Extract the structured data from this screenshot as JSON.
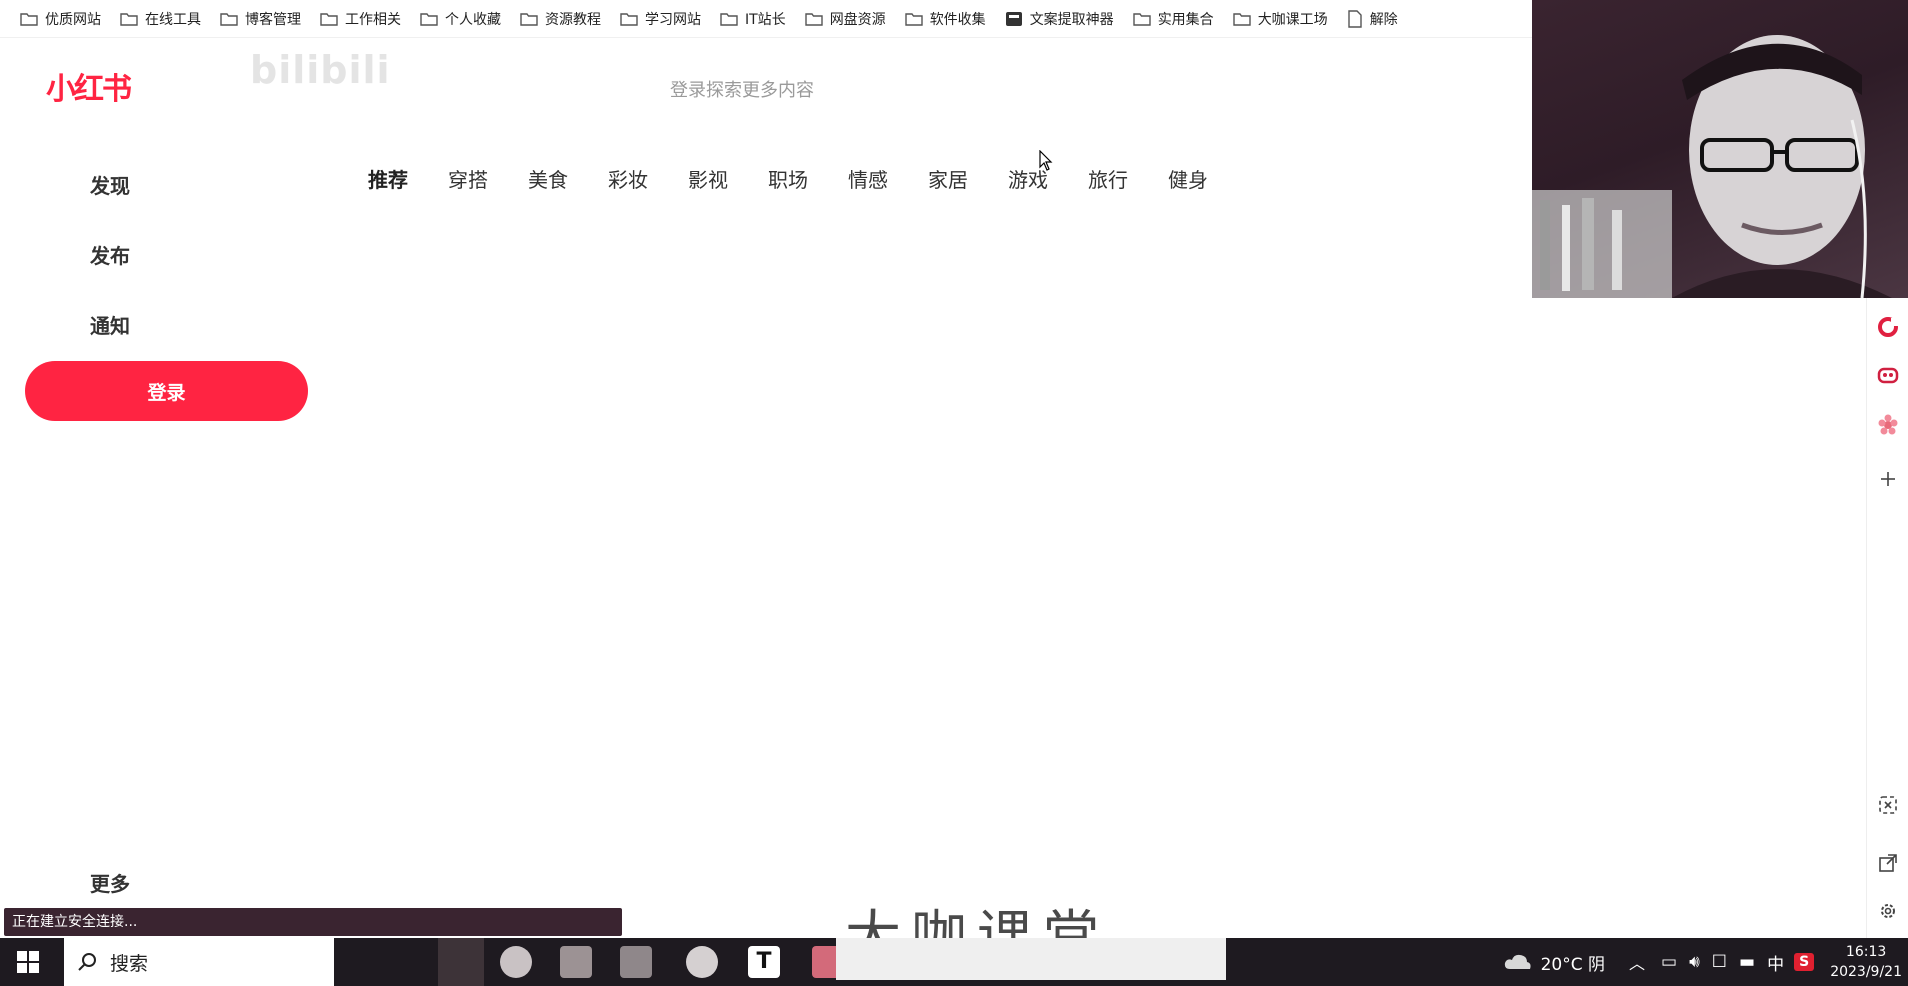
{
  "bookmarks": [
    {
      "label": "优质网站",
      "icon": "folder-icon"
    },
    {
      "label": "在线工具",
      "icon": "folder-icon"
    },
    {
      "label": "博客管理",
      "icon": "folder-icon"
    },
    {
      "label": "工作相关",
      "icon": "folder-icon"
    },
    {
      "label": "个人收藏",
      "icon": "folder-icon"
    },
    {
      "label": "资源教程",
      "icon": "folder-icon"
    },
    {
      "label": "学习网站",
      "icon": "folder-icon"
    },
    {
      "label": "IT站长",
      "icon": "folder-icon"
    },
    {
      "label": "网盘资源",
      "icon": "folder-icon"
    },
    {
      "label": "软件收集",
      "icon": "folder-icon"
    },
    {
      "label": "文案提取神器",
      "icon": "app-icon"
    },
    {
      "label": "实用集合",
      "icon": "folder-icon"
    },
    {
      "label": "大咖课工场",
      "icon": "folder-icon"
    },
    {
      "label": "解除",
      "icon": "page-icon"
    }
  ],
  "site": {
    "logo": "小红书",
    "search_hint": "登录探索更多内容",
    "watermark": "bilibili"
  },
  "nav": {
    "discover": "发现",
    "publish": "发布",
    "notify": "通知",
    "login": "登录",
    "more": "更多"
  },
  "channels": [
    "推荐",
    "穿搭",
    "美食",
    "彩妆",
    "影视",
    "职场",
    "情感",
    "家居",
    "游戏",
    "旅行",
    "健身"
  ],
  "active_channel": "推荐",
  "status": "正在建立安全连接...",
  "overlay_watermark": "大咖课堂",
  "taskbar": {
    "search": "搜索",
    "weather": "20°C 阴",
    "ime": "中",
    "time": "16:13",
    "date": "2023/9/21"
  },
  "colors": {
    "brand": "#ff2442",
    "status_bar": "#3a2430",
    "taskbar": "#1e1a20"
  }
}
